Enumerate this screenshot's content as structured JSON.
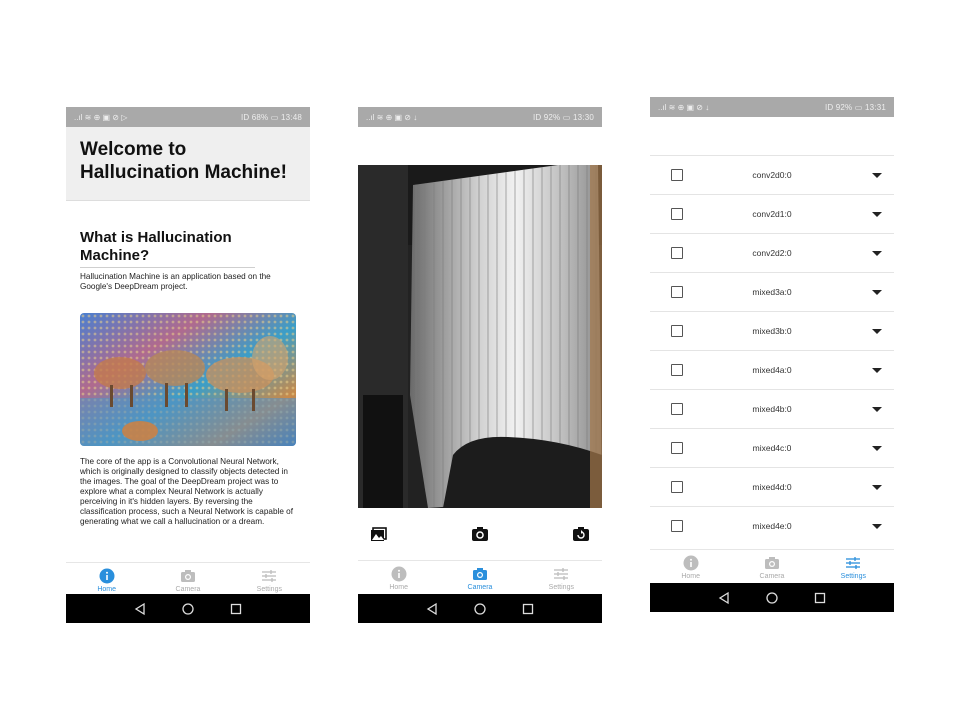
{
  "phones": [
    {
      "status": {
        "left": "..ıl ≋ ⊕ ▣ ⊘ ▷",
        "right": "ID 68% ▭ 13:48"
      },
      "home": {
        "title": "Welcome to Hallucination Machine!",
        "subtitle": "What is Hallucination Machine?",
        "intro": "Hallucination Machine is an application based on the Google's DeepDream project.",
        "body": "The core of the app is a Convolutional Neural Network, which is originally designed to classify objects detected in the images. The goal of the DeepDream project was to explore what a complex Neural Network is actually perceiving in it's hidden layers. By reversing the classification process, such a Neural Network is capable of generating what we call a hallucination or a dream."
      }
    },
    {
      "status": {
        "left": "..ıl ≋ ⊕ ▣ ⊘ ↓",
        "right": "ID 92% ▭ 13:30"
      }
    },
    {
      "status": {
        "left": "..ıl ≋ ⊕ ▣ ⊘ ↓",
        "right": "ID 92% ▭ 13:31"
      },
      "layers": [
        "conv2d0:0",
        "conv2d1:0",
        "conv2d2:0",
        "mixed3a:0",
        "mixed3b:0",
        "mixed4a:0",
        "mixed4b:0",
        "mixed4c:0",
        "mixed4d:0",
        "mixed4e:0"
      ]
    }
  ],
  "tabs": {
    "home": "Home",
    "camera": "Camera",
    "settings": "Settings"
  },
  "colors": {
    "accent": "#2a8fdc",
    "status_bar": "#a9a9a9",
    "nav_bar": "#000000",
    "header_bg": "#efefef"
  },
  "icons": [
    "info-icon",
    "camera-icon",
    "sliders-icon",
    "gallery-icon",
    "shutter-icon",
    "switch-camera-icon",
    "back-icon",
    "home-circle-icon",
    "recents-icon",
    "dropdown-icon"
  ]
}
